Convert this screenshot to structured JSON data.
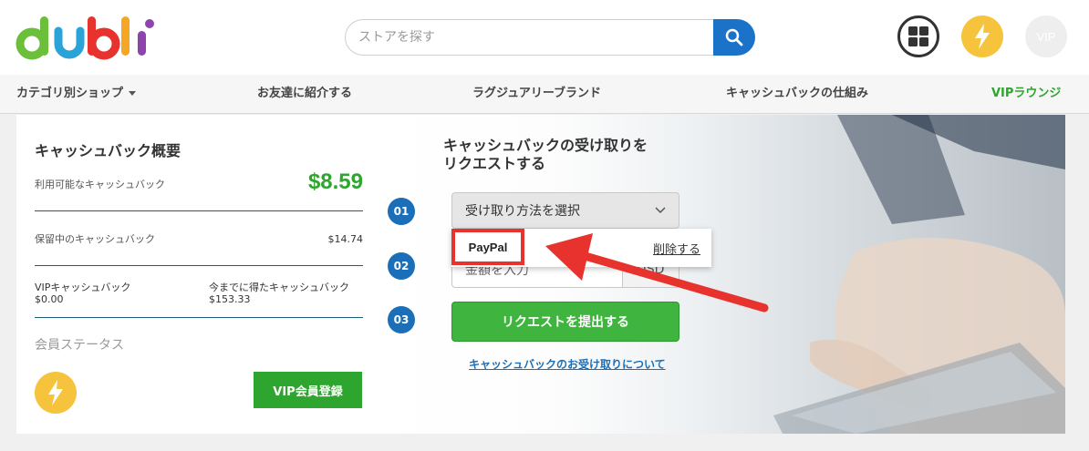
{
  "header": {
    "logo_text": "dubli",
    "search_placeholder": "ストアを探す",
    "vip_icon_label": "VIP",
    "icons": {
      "search": "search-icon",
      "grid": "grid-icon",
      "bolt": "lightning-bolt-icon"
    },
    "colors": {
      "search_button": "#1a73c8",
      "bolt": "#f5c43c"
    }
  },
  "nav": {
    "items": [
      {
        "label": "カテゴリ別ショップ"
      },
      {
        "label": "お友達に紹介する"
      },
      {
        "label": "ラグジュアリーブランド"
      },
      {
        "label": "キャッシュバックの仕組み"
      },
      {
        "label": "VIPラウンジ"
      }
    ]
  },
  "summary": {
    "title": "キャッシュバック概要",
    "available_label": "利用可能なキャッシュバック",
    "available_amount": "$8.59",
    "pending_label": "保留中のキャッシュバック",
    "pending_amount": "$14.74",
    "vip_label": "VIPキャッシュバック",
    "vip_amount": "$0.00",
    "earned_label": "今までに得たキャッシュバック",
    "earned_amount": "$153.33",
    "member_status": "会員ステータス",
    "vip_register": "VIP会員登録",
    "colors": {
      "amount": "#2ea52e",
      "button": "#2ea52e"
    }
  },
  "request": {
    "title": "キャッシュバックの受け取りを\nリクエストする",
    "steps": [
      "01",
      "02",
      "03"
    ],
    "select_label": "受け取り方法を選択",
    "amount_value": "金額を入力",
    "currency": "USD",
    "dropdown": {
      "option": "PayPal",
      "delete": "削除する"
    },
    "submit": "リクエストを提出する",
    "about_link": "キャッシュバックのお受け取りについて",
    "colors": {
      "step": "#1a6fb8",
      "submit": "#3fb53f",
      "highlight": "#e8322d"
    }
  }
}
